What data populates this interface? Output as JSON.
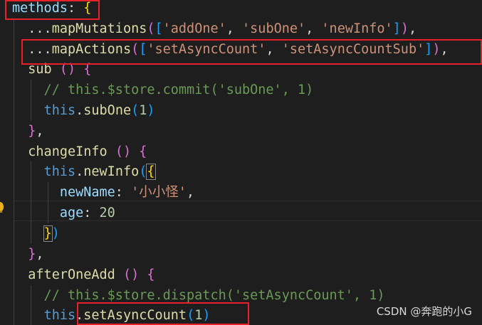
{
  "lines": [
    {
      "tokens": [
        {
          "t": "methods",
          "c": "c-prop"
        },
        {
          "t": ": ",
          "c": "c-plain"
        },
        {
          "t": "{",
          "c": "b-gold"
        }
      ]
    },
    {
      "tokens": [
        {
          "t": "  ...",
          "c": "c-plain"
        },
        {
          "t": "mapMutations",
          "c": "c-fn"
        },
        {
          "t": "(",
          "c": "b-orchid"
        },
        {
          "t": "[",
          "c": "b-blue"
        },
        {
          "t": "'addOne'",
          "c": "c-str"
        },
        {
          "t": ", ",
          "c": "c-plain"
        },
        {
          "t": "'subOne'",
          "c": "c-str"
        },
        {
          "t": ", ",
          "c": "c-plain"
        },
        {
          "t": "'newInfo'",
          "c": "c-str"
        },
        {
          "t": "]",
          "c": "b-blue"
        },
        {
          "t": ")",
          "c": "b-orchid"
        },
        {
          "t": ",",
          "c": "c-plain"
        }
      ]
    },
    {
      "tokens": [
        {
          "t": "  ...",
          "c": "c-plain"
        },
        {
          "t": "mapActions",
          "c": "c-fn"
        },
        {
          "t": "(",
          "c": "b-orchid"
        },
        {
          "t": "[",
          "c": "b-blue"
        },
        {
          "t": "'setAsyncCount'",
          "c": "c-str"
        },
        {
          "t": ", ",
          "c": "c-plain"
        },
        {
          "t": "'setAsyncCountSub'",
          "c": "c-str"
        },
        {
          "t": "]",
          "c": "b-blue"
        },
        {
          "t": ")",
          "c": "b-orchid"
        },
        {
          "t": ",",
          "c": "c-plain"
        }
      ]
    },
    {
      "tokens": [
        {
          "t": "  ",
          "c": "c-plain"
        },
        {
          "t": "sub",
          "c": "c-fn"
        },
        {
          "t": " ",
          "c": "c-plain"
        },
        {
          "t": "()",
          "c": "b-orchid"
        },
        {
          "t": " ",
          "c": "c-plain"
        },
        {
          "t": "{",
          "c": "b-orchid"
        }
      ]
    },
    {
      "tokens": [
        {
          "t": "    // this.$store.commit('subOne', 1)",
          "c": "c-com"
        }
      ]
    },
    {
      "tokens": [
        {
          "t": "    ",
          "c": "c-plain"
        },
        {
          "t": "this",
          "c": "c-kw"
        },
        {
          "t": ".",
          "c": "c-plain"
        },
        {
          "t": "subOne",
          "c": "c-fn"
        },
        {
          "t": "(",
          "c": "b-blue"
        },
        {
          "t": "1",
          "c": "c-num"
        },
        {
          "t": ")",
          "c": "b-blue"
        }
      ]
    },
    {
      "tokens": [
        {
          "t": "  ",
          "c": "c-plain"
        },
        {
          "t": "}",
          "c": "b-orchid"
        },
        {
          "t": ",",
          "c": "c-plain"
        }
      ]
    },
    {
      "tokens": [
        {
          "t": "  ",
          "c": "c-plain"
        },
        {
          "t": "changeInfo",
          "c": "c-fn"
        },
        {
          "t": " ",
          "c": "c-plain"
        },
        {
          "t": "()",
          "c": "b-orchid"
        },
        {
          "t": " ",
          "c": "c-plain"
        },
        {
          "t": "{",
          "c": "b-orchid"
        }
      ]
    },
    {
      "tokens": [
        {
          "t": "    ",
          "c": "c-plain"
        },
        {
          "t": "this",
          "c": "c-kw"
        },
        {
          "t": ".",
          "c": "c-plain"
        },
        {
          "t": "newInfo",
          "c": "c-fn"
        },
        {
          "t": "(",
          "c": "b-blue"
        },
        {
          "t": "{",
          "c": "b-gold",
          "match": true
        }
      ]
    },
    {
      "tokens": [
        {
          "t": "      ",
          "c": "c-plain"
        },
        {
          "t": "newName",
          "c": "c-prop"
        },
        {
          "t": ": ",
          "c": "c-plain"
        },
        {
          "t": "'小小怪'",
          "c": "c-str"
        },
        {
          "t": ",",
          "c": "c-plain"
        }
      ]
    },
    {
      "tokens": [
        {
          "t": "      ",
          "c": "c-plain"
        },
        {
          "t": "age",
          "c": "c-prop"
        },
        {
          "t": ": ",
          "c": "c-plain"
        },
        {
          "t": "20",
          "c": "c-num"
        }
      ]
    },
    {
      "tokens": [
        {
          "t": "    ",
          "c": "c-plain"
        },
        {
          "t": "}",
          "c": "b-gold",
          "match": true
        },
        {
          "t": ")",
          "c": "b-blue"
        }
      ]
    },
    {
      "tokens": [
        {
          "t": "  ",
          "c": "c-plain"
        },
        {
          "t": "}",
          "c": "b-orchid"
        },
        {
          "t": ",",
          "c": "c-plain"
        }
      ]
    },
    {
      "tokens": [
        {
          "t": "  ",
          "c": "c-plain"
        },
        {
          "t": "afterOneAdd",
          "c": "c-fn"
        },
        {
          "t": " ",
          "c": "c-plain"
        },
        {
          "t": "()",
          "c": "b-orchid"
        },
        {
          "t": " ",
          "c": "c-plain"
        },
        {
          "t": "{",
          "c": "b-orchid"
        }
      ]
    },
    {
      "tokens": [
        {
          "t": "    // this.$store.dispatch('setAsyncCount', 1)",
          "c": "c-com"
        }
      ]
    },
    {
      "tokens": [
        {
          "t": "    ",
          "c": "c-plain"
        },
        {
          "t": "this",
          "c": "c-kw"
        },
        {
          "t": ".",
          "c": "c-plain"
        },
        {
          "t": "setAsyncCount",
          "c": "c-fn"
        },
        {
          "t": "(",
          "c": "b-blue"
        },
        {
          "t": "1",
          "c": "c-num"
        },
        {
          "t": ")",
          "c": "b-blue"
        }
      ]
    }
  ],
  "watermark": "CSDN @奔跑的小G"
}
